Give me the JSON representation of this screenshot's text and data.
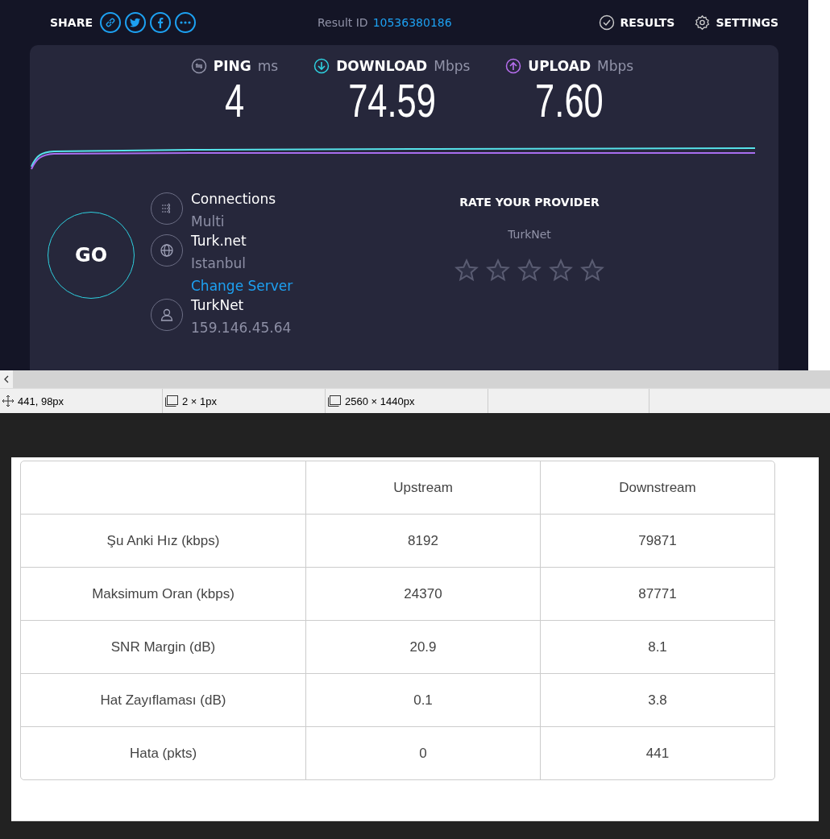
{
  "header": {
    "share_label": "SHARE",
    "result_label": "Result ID",
    "result_id": "10536380186",
    "nav": [
      {
        "kind": "results",
        "label": "RESULTS"
      },
      {
        "kind": "settings",
        "label": "SETTINGS"
      }
    ]
  },
  "metrics": [
    {
      "kind": "ping",
      "label": "PING",
      "unit": "ms",
      "value": "4"
    },
    {
      "kind": "download",
      "label": "DOWNLOAD",
      "unit": "Mbps",
      "value": "74.59"
    },
    {
      "kind": "upload",
      "label": "UPLOAD",
      "unit": "Mbps",
      "value": "7.60"
    }
  ],
  "go_label": "GO",
  "info": [
    {
      "kind": "connections",
      "title": "Connections",
      "subtitle": "Multi"
    },
    {
      "kind": "server",
      "title": "Turk.net",
      "subtitle": "Istanbul",
      "link": "Change Server"
    },
    {
      "kind": "user",
      "title": "TurkNet",
      "subtitle": "159.146.45.64"
    }
  ],
  "rating": {
    "title": "RATE YOUR PROVIDER",
    "provider": "TurkNet",
    "stars": 0
  },
  "status_bar": [
    {
      "kind": "cursor",
      "text": "441, 98px"
    },
    {
      "kind": "selection",
      "text": "2 × 1px"
    },
    {
      "kind": "image",
      "text": "2560 × 1440px"
    }
  ],
  "table": {
    "columns": [
      "",
      "Upstream",
      "Downstream"
    ],
    "rows": [
      [
        "Şu Anki Hız (kbps)",
        "8192",
        "79871"
      ],
      [
        "Maksimum Oran (kbps)",
        "24370",
        "87771"
      ],
      [
        "SNR Margin (dB)",
        "20.9",
        "8.1"
      ],
      [
        "Hat Zayıflaması (dB)",
        "0.1",
        "3.8"
      ],
      [
        "Hata (pkts)",
        "0",
        "441"
      ]
    ]
  }
}
